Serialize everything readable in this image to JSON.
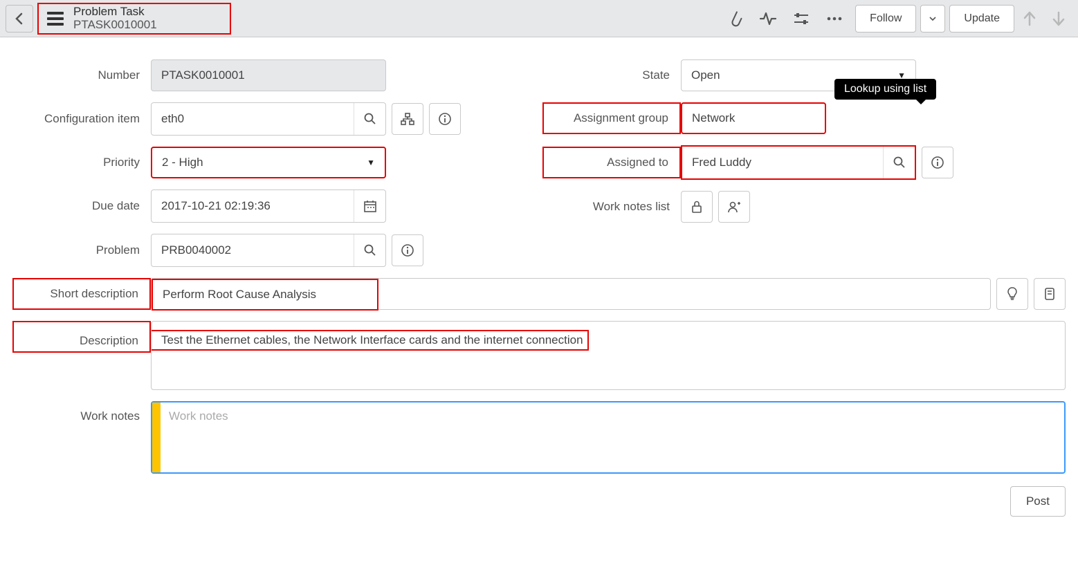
{
  "header": {
    "title": "Problem Task",
    "subtitle": "PTASK0010001",
    "follow_label": "Follow",
    "update_label": "Update"
  },
  "tooltip": {
    "text": "Lookup using list"
  },
  "left": {
    "number": {
      "label": "Number",
      "value": "PTASK0010001"
    },
    "ci": {
      "label": "Configuration item",
      "value": "eth0"
    },
    "priority": {
      "label": "Priority",
      "value": "2 - High"
    },
    "due": {
      "label": "Due date",
      "value": "2017-10-21 02:19:36"
    },
    "problem": {
      "label": "Problem",
      "value": "PRB0040002"
    }
  },
  "right": {
    "state": {
      "label": "State",
      "value": "Open"
    },
    "agroup": {
      "label": "Assignment group",
      "value": "Network"
    },
    "assigned": {
      "label": "Assigned to",
      "value": "Fred Luddy"
    },
    "wnl": {
      "label": "Work notes list"
    }
  },
  "short_desc": {
    "label": "Short description",
    "value": "Perform Root Cause Analysis"
  },
  "description": {
    "label": "Description",
    "value": "Test the Ethernet cables, the Network Interface cards and the internet connection"
  },
  "work_notes": {
    "label": "Work notes",
    "placeholder": "Work notes"
  },
  "post_label": "Post"
}
